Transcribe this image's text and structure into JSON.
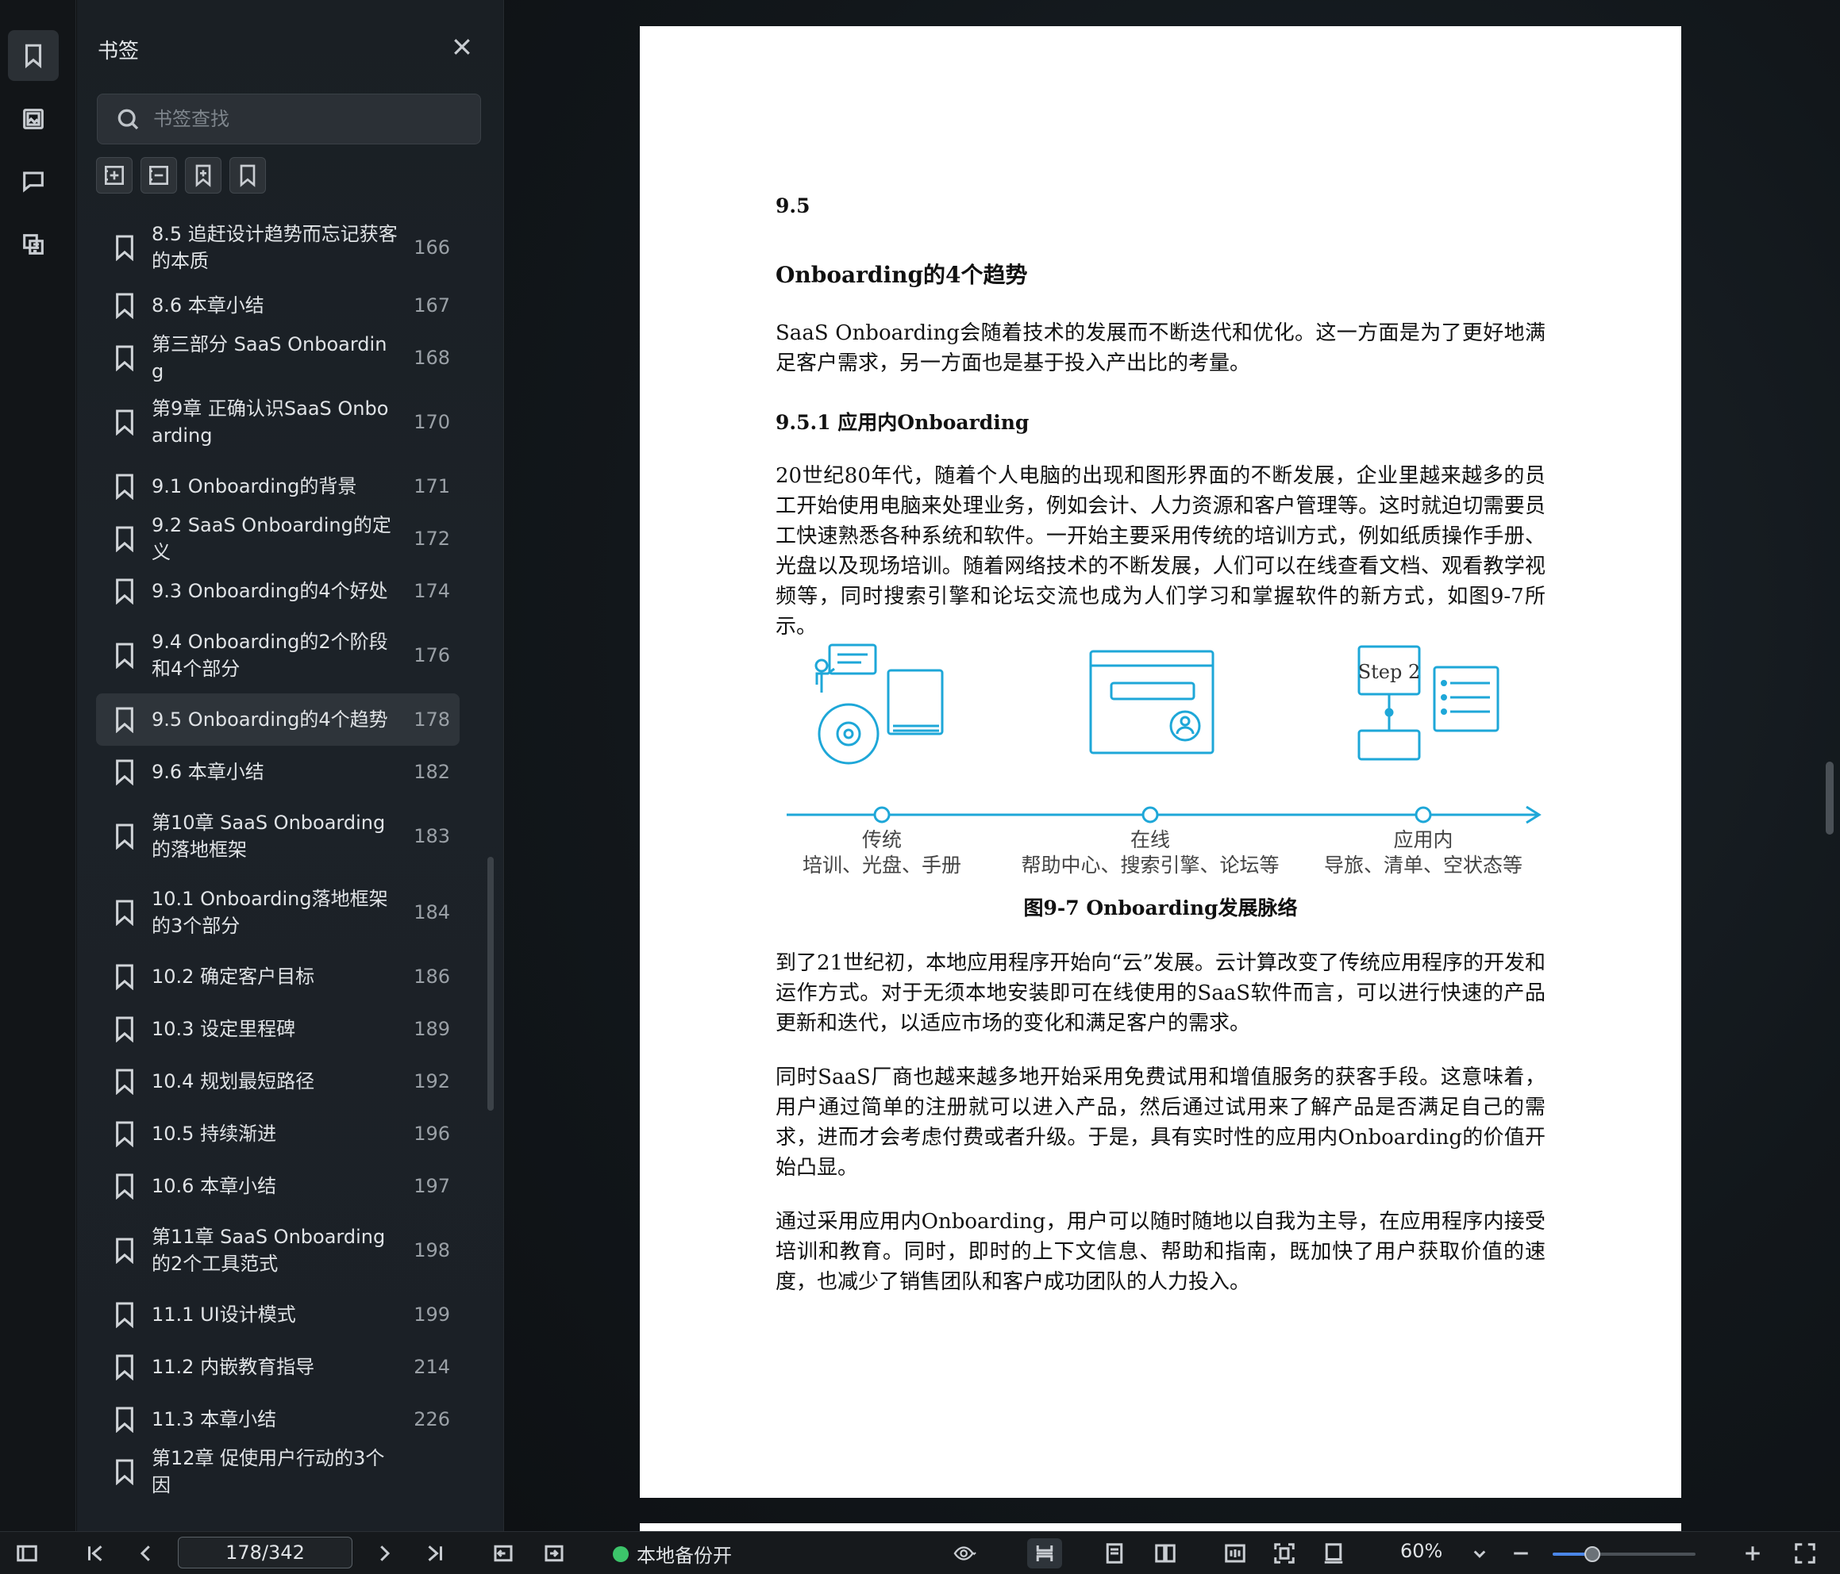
{
  "panel": {
    "title": "书签",
    "search_placeholder": "书签查找",
    "bookmarks": [
      {
        "label": "8.5 追赶设计趋势而忘记获客的本质",
        "page": "166"
      },
      {
        "label": "8.6 本章小结",
        "page": "167"
      },
      {
        "label": "第三部分 SaaS Onboarding",
        "page": "168"
      },
      {
        "label": "第9章 正确认识SaaS Onboarding",
        "page": "170"
      },
      {
        "label": "9.1 Onboarding的背景",
        "page": "171"
      },
      {
        "label": "9.2 SaaS Onboarding的定义",
        "page": "172"
      },
      {
        "label": "9.3 Onboarding的4个好处",
        "page": "174"
      },
      {
        "label": "9.4 Onboarding的2个阶段和4个部分",
        "page": "176"
      },
      {
        "label": "9.5 Onboarding的4个趋势",
        "page": "178",
        "active": true
      },
      {
        "label": "9.6 本章小结",
        "page": "182"
      },
      {
        "label": "第10章 SaaS Onboarding的落地框架",
        "page": "183"
      },
      {
        "label": "10.1 Onboarding落地框架的3个部分",
        "page": "184"
      },
      {
        "label": "10.2 确定客户目标",
        "page": "186"
      },
      {
        "label": "10.3 设定里程碑",
        "page": "189"
      },
      {
        "label": "10.4 规划最短路径",
        "page": "192"
      },
      {
        "label": "10.5 持续渐进",
        "page": "196"
      },
      {
        "label": "10.6 本章小结",
        "page": "197"
      },
      {
        "label": "第11章 SaaS Onboarding的2个工具范式",
        "page": "198"
      },
      {
        "label": "11.1 UI设计模式",
        "page": "199"
      },
      {
        "label": "11.2 内嵌教育指导",
        "page": "214"
      },
      {
        "label": "11.3 本章小结",
        "page": "226"
      },
      {
        "label": "第12章 促使用户行动的3个因",
        "page": ""
      }
    ]
  },
  "page": {
    "section_number": "9.5",
    "section_title": "Onboarding的4个趋势",
    "para1": "SaaS Onboarding会随着技术的发展而不断迭代和优化。这一方面是为了更好地满足客户需求，另一方面也是基于投入产出比的考量。",
    "subsection": "9.5.1 应用内Onboarding",
    "para2": "20世纪80年代，随着个人电脑的出现和图形界面的不断发展，企业里越来越多的员工开始使用电脑来处理业务，例如会计、人力资源和客户管理等。这时就迫切需要员工快速熟悉各种系统和软件。一开始主要采用传统的培训方式，例如纸质操作手册、光盘以及现场培训。随着网络技术的不断发展，人们可以在线查看文档、观看教学视频等，同时搜索引擎和论坛交流也成为人们学习和掌握软件的新方式，如图9-7所示。",
    "figure": {
      "step_label": "Step 2",
      "stages": [
        {
          "title": "传统",
          "desc": "培训、光盘、手册"
        },
        {
          "title": "在线",
          "desc": "帮助中心、搜索引擎、论坛等"
        },
        {
          "title": "应用内",
          "desc": "导旅、清单、空状态等"
        }
      ],
      "accent": "#1ea7d8"
    },
    "caption": "图9-7 Onboarding发展脉络",
    "para3": "到了21世纪初，本地应用程序开始向“云”发展。云计算改变了传统应用程序的开发和运作方式。对于无须本地安装即可在线使用的SaaS软件而言，可以进行快速的产品更新和迭代，以适应市场的变化和满足客户的需求。",
    "para4": "同时SaaS厂商也越来越多地开始采用免费试用和增值服务的获客手段。这意味着，用户通过简单的注册就可以进入产品，然后通过试用来了解产品是否满足自己的需求，进而才会考虑付费或者升级。于是，具有实时性的应用内Onboarding的价值开始凸显。",
    "para5": "通过采用应用内Onboarding，用户可以随时随地以自我为主导，在应用程序内接受培训和教育。同时，即时的上下文信息、帮助和指南，既加快了用户获取价值的速度，也减少了销售团队和客户成功团队的人力投入。"
  },
  "bottombar": {
    "page_indicator": "178/342",
    "backup_label": "本地备份开",
    "zoom": "60%",
    "zoom_fraction": 0.28,
    "status_color": "#3cc46a"
  }
}
